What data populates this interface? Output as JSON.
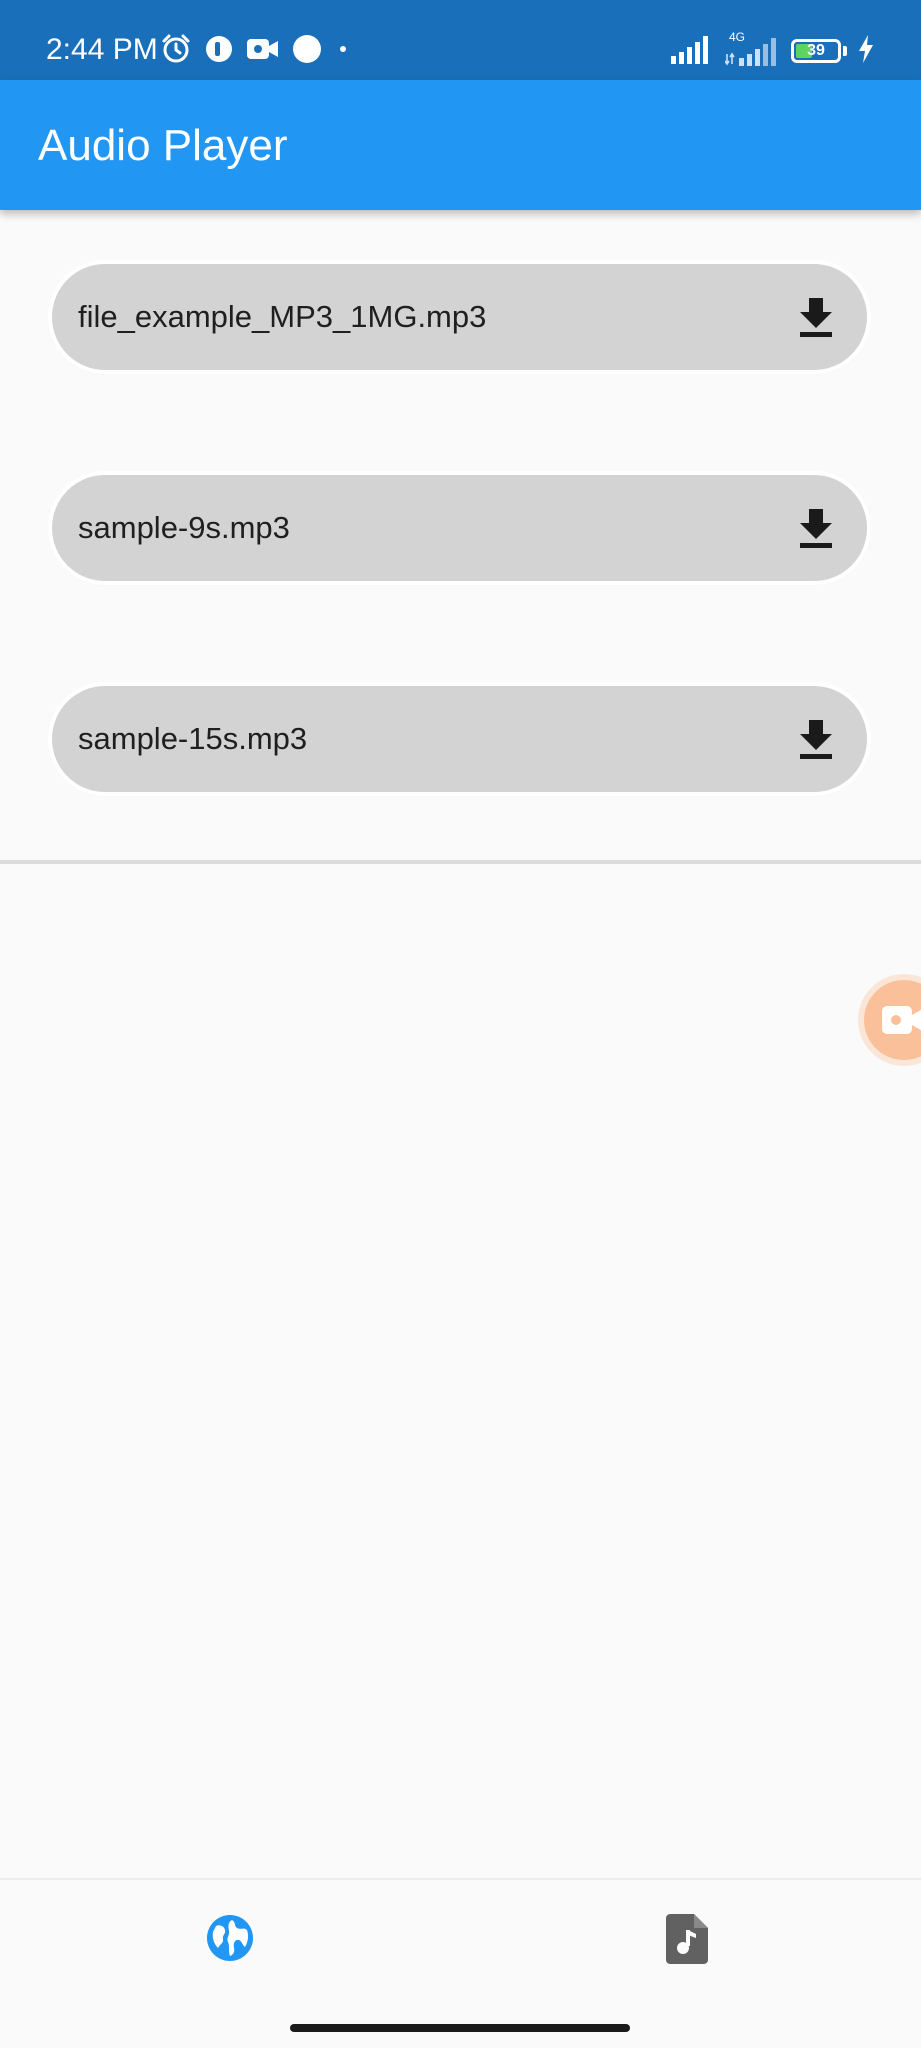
{
  "status_bar": {
    "time": "2:44 PM",
    "left_icons": [
      "alarm-icon",
      "app-notification-icon",
      "screen-record-icon",
      "circle-notification-icon",
      "more-dot-icon"
    ],
    "network_label": "4G",
    "battery_level": "39",
    "charging": true
  },
  "app_bar": {
    "title": "Audio Player"
  },
  "audio_files": [
    {
      "name": "file_example_MP3_1MG.mp3",
      "action_icon": "download-icon"
    },
    {
      "name": "sample-9s.mp3",
      "action_icon": "download-icon"
    },
    {
      "name": "sample-15s.mp3",
      "action_icon": "download-icon"
    }
  ],
  "bottom_nav": {
    "items": [
      {
        "icon": "globe-icon",
        "active": true
      },
      {
        "icon": "audio-file-icon",
        "active": false
      }
    ]
  },
  "colors": {
    "status_bar": "#1a6fba",
    "app_bar": "#2196f3",
    "item_background": "#d3d3d3",
    "active_nav": "#2196f3",
    "inactive_nav": "#616161",
    "recorder_bubble": "#f9c09a"
  }
}
